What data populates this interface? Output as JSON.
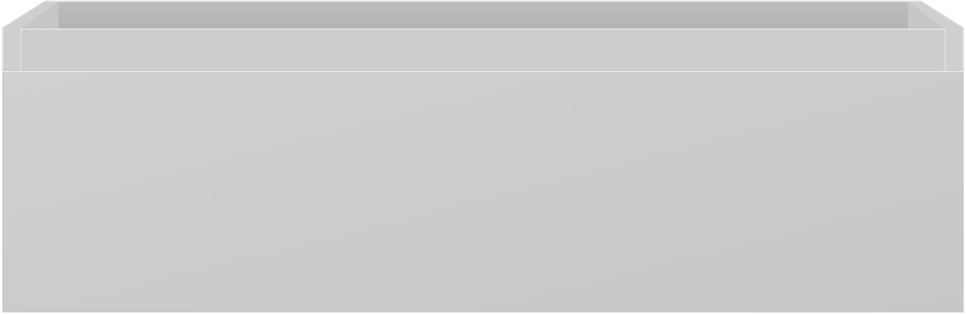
{
  "colors": {
    "background": "#ffffff",
    "front_panel": "#cbcbc9",
    "inner_back_wall": "#b9b9b8",
    "inner_side_wall": "#d3d3d1",
    "top_edge": "#c2c2c0",
    "rim": "#dededd",
    "outline": "#b4b4b2"
  },
  "object": {
    "name": "drawer",
    "view": "front"
  }
}
